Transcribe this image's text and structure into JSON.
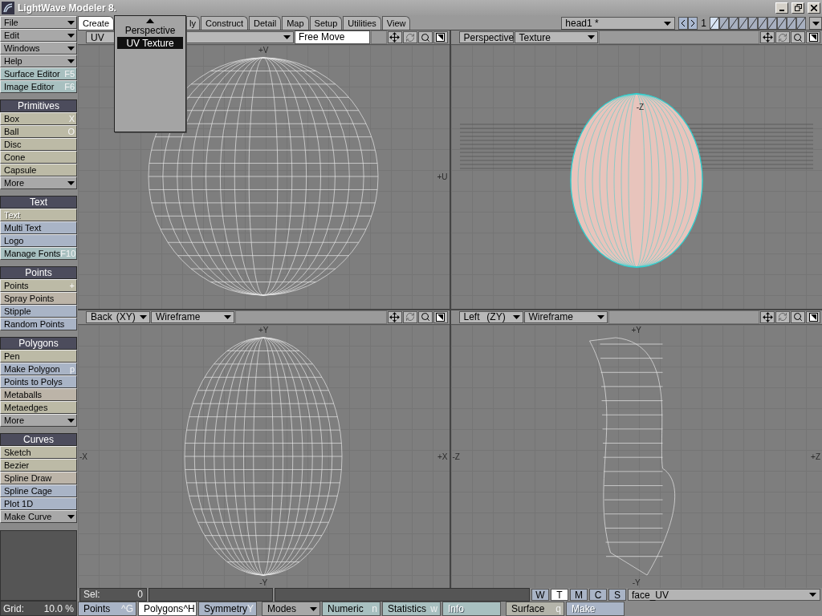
{
  "window": {
    "title": "LightWave Modeler 8."
  },
  "menus": [
    {
      "label": "File"
    },
    {
      "label": "Edit"
    },
    {
      "label": "Windows"
    },
    {
      "label": "Help"
    }
  ],
  "editors": [
    {
      "label": "Surface Editor",
      "shortcut": "F5"
    },
    {
      "label": "Image Editor",
      "shortcut": "F6"
    }
  ],
  "groups": [
    {
      "title": "Primitives",
      "items": [
        {
          "label": "Box",
          "shortcut": "X",
          "color": "#bcbaa6",
          "disabled": false,
          "kind": "button"
        },
        {
          "label": "Ball",
          "shortcut": "O",
          "color": "#bcbaa6",
          "disabled": false,
          "kind": "button"
        },
        {
          "label": "Disc",
          "color": "#bcbaa6",
          "disabled": false,
          "kind": "button"
        },
        {
          "label": "Cone",
          "color": "#bcbaa6",
          "disabled": false,
          "kind": "button"
        },
        {
          "label": "Capsule",
          "color": "#bcbaa6",
          "disabled": false,
          "kind": "button"
        },
        {
          "label": "More",
          "color": "#a8a8a8",
          "disabled": false,
          "kind": "menu"
        }
      ]
    },
    {
      "title": "Text",
      "items": [
        {
          "label": "Text",
          "color": "#bcbaa6",
          "disabled": true,
          "kind": "button"
        },
        {
          "label": "Multi Text",
          "color": "#a9b4c6",
          "disabled": false,
          "kind": "button"
        },
        {
          "label": "Logo",
          "color": "#a9b4c6",
          "disabled": false,
          "kind": "button"
        },
        {
          "label": "Manage Fonts",
          "shortcut": "F10",
          "color": "#a8c0c0",
          "disabled": false,
          "kind": "button"
        }
      ]
    },
    {
      "title": "Points",
      "items": [
        {
          "label": "Points",
          "shortcut": "+",
          "color": "#bcbaa6",
          "disabled": false,
          "kind": "button"
        },
        {
          "label": "Spray Points",
          "color": "#bcb4a8",
          "disabled": false,
          "kind": "button"
        },
        {
          "label": "Stipple",
          "color": "#a9b4c6",
          "disabled": false,
          "kind": "button"
        },
        {
          "label": "Random Points",
          "color": "#a9b4c6",
          "disabled": false,
          "kind": "button"
        }
      ]
    },
    {
      "title": "Polygons",
      "items": [
        {
          "label": "Pen",
          "color": "#bcbaa6",
          "disabled": false,
          "kind": "button"
        },
        {
          "label": "Make Polygon",
          "shortcut": "p",
          "color": "#a9b4c6",
          "disabled": false,
          "kind": "button"
        },
        {
          "label": "Points to Polys",
          "color": "#a9b4c6",
          "disabled": false,
          "kind": "button"
        },
        {
          "label": "Metaballs",
          "color": "#bcb4a8",
          "disabled": false,
          "kind": "button"
        },
        {
          "label": "Metaedges",
          "color": "#bcbaa6",
          "disabled": false,
          "kind": "button"
        },
        {
          "label": "More",
          "color": "#a8a8a8",
          "disabled": false,
          "kind": "menu"
        }
      ]
    },
    {
      "title": "Curves",
      "items": [
        {
          "label": "Sketch",
          "color": "#bcbaa6",
          "disabled": false,
          "kind": "button"
        },
        {
          "label": "Bezier",
          "color": "#bcbaa6",
          "disabled": false,
          "kind": "button"
        },
        {
          "label": "Spline Draw",
          "color": "#bcb4a8",
          "disabled": false,
          "kind": "button"
        },
        {
          "label": "Spline Cage",
          "color": "#a9b4c6",
          "disabled": false,
          "kind": "button"
        },
        {
          "label": "Plot 1D",
          "color": "#a9b4c6",
          "disabled": false,
          "kind": "button"
        },
        {
          "label": "Make Curve",
          "color": "#a8a8a8",
          "disabled": false,
          "kind": "menu"
        }
      ]
    }
  ],
  "grid": {
    "label": "Grid:",
    "value": "10.0 %"
  },
  "tabs": [
    {
      "label": "Create",
      "selected": true,
      "kind": "tab"
    },
    {
      "label": "ly",
      "selected": false,
      "kind": "covered"
    },
    {
      "label": "Construct",
      "selected": false,
      "kind": "tab"
    },
    {
      "label": "Detail",
      "selected": false,
      "kind": "tab"
    },
    {
      "label": "Map",
      "selected": false,
      "kind": "tab"
    },
    {
      "label": "Setup",
      "selected": false,
      "kind": "tab"
    },
    {
      "label": "Utilities",
      "selected": false,
      "kind": "tab"
    },
    {
      "label": "View",
      "selected": false,
      "kind": "tab"
    }
  ],
  "object": {
    "name": "head1 *"
  },
  "layer_number": "1",
  "layers": [
    {
      "selected": true
    },
    {
      "selected": false
    },
    {
      "selected": false
    },
    {
      "selected": false
    },
    {
      "selected": false
    },
    {
      "selected": false
    },
    {
      "selected": false
    },
    {
      "selected": false
    },
    {
      "selected": false
    },
    {
      "selected": false
    }
  ],
  "popup": {
    "items": [
      {
        "label": "Perspective",
        "selected": false
      },
      {
        "label": "UV Texture",
        "selected": true
      }
    ]
  },
  "viewports": [
    {
      "kind": "uv",
      "view": "UV",
      "field": "Free Move",
      "axis_labels": {
        "top": "+V",
        "right": "+U"
      }
    },
    {
      "kind": "perspective",
      "view": "Perspective",
      "mode": "Texture",
      "axis_labels": {
        "top": "-Z"
      }
    },
    {
      "kind": "front",
      "view": "Back",
      "axes": "(XY)",
      "mode": "Wireframe",
      "axis_labels": {
        "top": "+Y",
        "left": "-X",
        "right": "+X",
        "bottom": "-Y"
      }
    },
    {
      "kind": "side",
      "view": "Left",
      "axes": "(ZY)",
      "mode": "Wireframe",
      "axis_labels": {
        "top": "+Y",
        "left": "-Z",
        "right": "+Z",
        "bottom": "-Y"
      }
    }
  ],
  "status": {
    "sel_label": "Sel:",
    "sel_value": "0"
  },
  "vmap_buttons": [
    {
      "label": "W",
      "selected": false
    },
    {
      "label": "T",
      "selected": true
    },
    {
      "label": "M",
      "selected": false
    },
    {
      "label": "C",
      "selected": false
    },
    {
      "label": "S",
      "selected": false
    }
  ],
  "vmap": "face_UV",
  "mode_groups": [
    [
      {
        "label": "Points",
        "shortcut": "^G",
        "color": "#a9b4c6",
        "selected": false,
        "disabled": false,
        "kind": "toggle"
      },
      {
        "label": "Polygons",
        "shortcut": "^H",
        "selected": true,
        "disabled": false,
        "kind": "toggle"
      },
      {
        "label": "Symmetry",
        "shortcut": "Y",
        "color": "#a9b4c6",
        "selected": false,
        "disabled": false,
        "kind": "toggle"
      }
    ],
    [
      {
        "label": "Modes",
        "color": "#a8a8a8",
        "selected": false,
        "disabled": false,
        "kind": "menu"
      },
      {
        "label": "Numeric",
        "shortcut": "n",
        "color": "#a8c0c0",
        "selected": false,
        "disabled": false,
        "kind": "toggle"
      },
      {
        "label": "Statistics",
        "shortcut": "w",
        "color": "#a8c0c0",
        "selected": false,
        "disabled": false,
        "kind": "toggle"
      },
      {
        "label": "Info",
        "color": "#a8c0c0",
        "selected": false,
        "disabled": true,
        "kind": "toggle"
      }
    ],
    [
      {
        "label": "Surface",
        "shortcut": "q",
        "color": "#b4b4aa",
        "selected": false,
        "disabled": false,
        "kind": "toggle"
      },
      {
        "label": "Make",
        "color": "#a9b4c6",
        "selected": false,
        "disabled": true,
        "kind": "toggle"
      }
    ]
  ]
}
